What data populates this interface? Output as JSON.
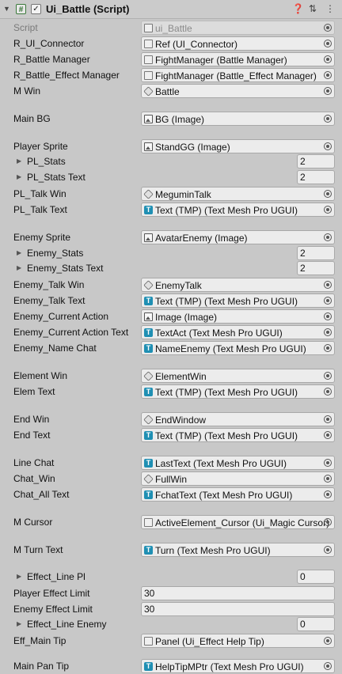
{
  "header": {
    "title": "Ui_Battle (Script)",
    "script_icon": "#",
    "check": "✓"
  },
  "script": {
    "label": "Script",
    "value": "ui_Battle"
  },
  "rows": [
    {
      "label": "R_UI_Connector",
      "value": "Ref (UI_Connector)",
      "icon": "script"
    },
    {
      "label": "R_Battle Manager",
      "value": "FightManager (Battle Manager)",
      "icon": "script"
    },
    {
      "label": "R_Battle_Effect Manager",
      "value": "FightManager (Battle_Effect Manager)",
      "icon": "script"
    },
    {
      "label": "M Win",
      "value": "Battle",
      "icon": "gameobject"
    },
    {
      "label": "Main BG",
      "value": "BG (Image)",
      "icon": "image"
    },
    {
      "label": "Player Sprite",
      "value": "StandGG (Image)",
      "icon": "image"
    },
    {
      "label": "PL_Stats",
      "value": "2",
      "type": "fold"
    },
    {
      "label": "PL_Stats Text",
      "value": "2",
      "type": "fold"
    },
    {
      "label": "PL_Talk Win",
      "value": "MeguminTalk",
      "icon": "gameobject"
    },
    {
      "label": "PL_Talk Text",
      "value": "Text (TMP) (Text Mesh Pro UGUI)",
      "icon": "tmp"
    },
    {
      "label": "Enemy Sprite",
      "value": "AvatarEnemy (Image)",
      "icon": "image"
    },
    {
      "label": "Enemy_Stats",
      "value": "2",
      "type": "fold"
    },
    {
      "label": "Enemy_Stats Text",
      "value": "2",
      "type": "fold"
    },
    {
      "label": "Enemy_Talk Win",
      "value": "EnemyTalk",
      "icon": "gameobject"
    },
    {
      "label": "Enemy_Talk Text",
      "value": "Text (TMP) (Text Mesh Pro UGUI)",
      "icon": "tmp"
    },
    {
      "label": "Enemy_Current Action",
      "value": "Image (Image)",
      "icon": "image"
    },
    {
      "label": "Enemy_Current Action Text",
      "value": "TextAct (Text Mesh Pro UGUI)",
      "icon": "tmp"
    },
    {
      "label": "Enemy_Name Chat",
      "value": "NameEnemy (Text Mesh Pro UGUI)",
      "icon": "tmp"
    },
    {
      "label": "Element Win",
      "value": "ElementWin",
      "icon": "gameobject"
    },
    {
      "label": "Elem Text",
      "value": "Text (TMP) (Text Mesh Pro UGUI)",
      "icon": "tmp"
    },
    {
      "label": "End Win",
      "value": "EndWindow",
      "icon": "gameobject"
    },
    {
      "label": "End Text",
      "value": "Text (TMP) (Text Mesh Pro UGUI)",
      "icon": "tmp"
    },
    {
      "label": "Line Chat",
      "value": "LastText (Text Mesh Pro UGUI)",
      "icon": "tmp"
    },
    {
      "label": "Chat_Win",
      "value": "FullWin",
      "icon": "gameobject"
    },
    {
      "label": "Chat_All Text",
      "value": "FchatText (Text Mesh Pro UGUI)",
      "icon": "tmp"
    },
    {
      "label": "M Cursor",
      "value": "ActiveElement_Cursor (Ui_Magic Cursor)",
      "icon": "script"
    },
    {
      "label": "M Turn Text",
      "value": "Turn (Text Mesh Pro UGUI)",
      "icon": "tmp"
    },
    {
      "label": "Effect_Line Pl",
      "value": "0",
      "type": "fold"
    },
    {
      "label": "Player Effect Limit",
      "value": "30",
      "type": "int"
    },
    {
      "label": "Enemy Effect Limit",
      "value": "30",
      "type": "int"
    },
    {
      "label": "Effect_Line Enemy",
      "value": "0",
      "type": "fold"
    },
    {
      "label": "Eff_Main Tip",
      "value": "Panel (Ui_Effect Help Tip)",
      "icon": "script"
    },
    {
      "label": "Main Pan Tip",
      "value": "HelpTipMPtr (Text Mesh Pro UGUI)",
      "icon": "tmp"
    }
  ]
}
